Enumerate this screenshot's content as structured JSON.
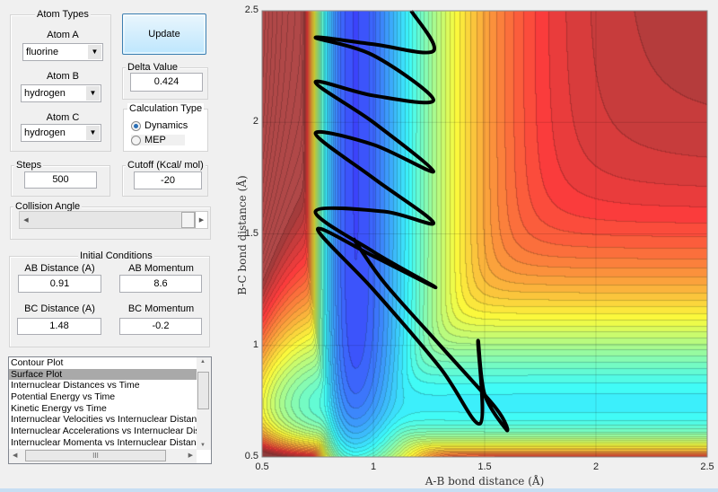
{
  "atom_types": {
    "title": "Atom Types",
    "atom_a": {
      "label": "Atom A",
      "value": "fluorine"
    },
    "atom_b": {
      "label": "Atom B",
      "value": "hydrogen"
    },
    "atom_c": {
      "label": "Atom C",
      "value": "hydrogen"
    }
  },
  "update_button": "Update",
  "delta": {
    "title": "Delta Value",
    "value": "0.424"
  },
  "calc_type": {
    "title": "Calculation Type",
    "options": [
      "Dynamics",
      "MEP"
    ],
    "selected": "Dynamics"
  },
  "steps": {
    "title": "Steps",
    "value": "500"
  },
  "cutoff": {
    "title": "Cutoff (Kcal/ mol)",
    "value": "-20"
  },
  "collision_angle": {
    "title": "Collision Angle",
    "slider_fraction": 1.0
  },
  "initial_conditions": {
    "title": "Initial Conditions",
    "ab_distance": {
      "label": "AB Distance (A)",
      "value": "0.91"
    },
    "ab_momentum": {
      "label": "AB Momentum",
      "value": "8.6"
    },
    "bc_distance": {
      "label": "BC Distance (A)",
      "value": "1.48"
    },
    "bc_momentum": {
      "label": "BC Momentum",
      "value": "-0.2"
    }
  },
  "plot_list": {
    "items": [
      "Contour Plot",
      "Surface Plot",
      "Internuclear Distances vs Time",
      "Potential Energy vs Time",
      "Kinetic Energy vs Time",
      "Internuclear Velocities vs Internuclear Distance",
      "Internuclear Accelerations vs Internuclear Distance",
      "Internuclear Momenta vs Internuclear Distance"
    ],
    "selected": "Surface Plot",
    "hscroll_grip": "III"
  },
  "chart_data": {
    "type": "contour",
    "xlabel": "A-B bond distance (Å)",
    "ylabel": "B-C bond distance (Å)",
    "xlim": [
      0.5,
      2.5
    ],
    "ylim": [
      0.5,
      2.5
    ],
    "xticks": [
      "0.5",
      "1",
      "1.5",
      "2",
      "2.5"
    ],
    "yticks": [
      "0.5",
      "1",
      "1.5",
      "2",
      "2.5"
    ],
    "grid": true,
    "colormap": "jet",
    "clipped_color": "#b04848",
    "trajectory": {
      "color": "#000000",
      "x": [
        0.91,
        1.05,
        1.3,
        1.55,
        1.6,
        1.5,
        1.47,
        1.48,
        1.3,
        1.0,
        0.75,
        1.0,
        1.28,
        1.0,
        0.74,
        1.05,
        1.27,
        1.0,
        0.74,
        1.0,
        1.27,
        1.0,
        0.74,
        1.0,
        1.27,
        1.0,
        0.74,
        1.0,
        1.27,
        1.17
      ],
      "y": [
        1.48,
        1.28,
        1.0,
        0.72,
        0.62,
        0.78,
        1.02,
        0.65,
        0.9,
        1.25,
        1.52,
        1.4,
        1.26,
        1.42,
        1.6,
        1.6,
        1.55,
        1.75,
        1.95,
        1.9,
        1.78,
        2.0,
        2.18,
        2.12,
        2.1,
        2.3,
        2.38,
        2.35,
        2.32,
        2.5
      ]
    }
  }
}
